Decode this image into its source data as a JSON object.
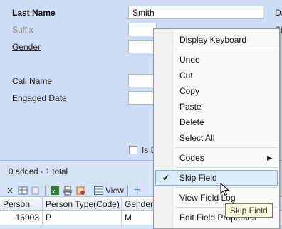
{
  "form": {
    "last_name_label": "Last Name",
    "last_name_value": "Smith",
    "suffix_label": "Suffix",
    "gender_label": "Gender",
    "call_name_label": "Call Name",
    "engaged_date_label": "Engaged Date",
    "right_cut_1": "Da",
    "right_cut_2": "Bi",
    "checkbox_label": "Is D"
  },
  "grid": {
    "status": "0 added - 1 total",
    "view_label": "View",
    "columns": [
      "Person",
      "Person Type(Code)",
      "Gender ("
    ],
    "rows": [
      [
        "15903",
        "P",
        "M"
      ]
    ]
  },
  "context_menu": {
    "items": [
      {
        "label": "Display Keyboard"
      },
      {
        "label": "Undo"
      },
      {
        "label": "Cut"
      },
      {
        "label": "Copy"
      },
      {
        "label": "Paste"
      },
      {
        "label": "Delete"
      },
      {
        "label": "Select All"
      },
      {
        "label": "Codes"
      },
      {
        "label": "Skip Field",
        "checked": true
      },
      {
        "label": "View Field Log"
      },
      {
        "label": "Edit Field Properties"
      }
    ]
  },
  "tooltip": "Skip Field",
  "colors": {
    "form_bg": "#cfddf4",
    "menu_highlight": "#dcebfc",
    "menu_highlight_border": "#7eb4ea"
  }
}
